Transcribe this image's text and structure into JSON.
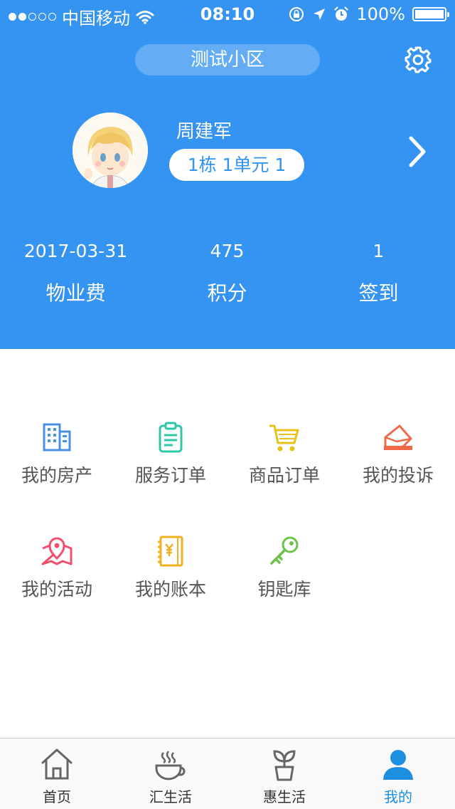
{
  "status_bar": {
    "carrier": "中国移动",
    "time": "08:10",
    "battery": "100%",
    "battery_level": 1.0,
    "signal_bars": 2
  },
  "header": {
    "community": "测试小区",
    "settings_icon": "gear-icon"
  },
  "profile": {
    "name": "周建军",
    "unit": "1栋 1单元 1",
    "avatar_icon": "avatar-cartoon"
  },
  "stats": [
    {
      "value": "2017-03-31",
      "label": "物业费"
    },
    {
      "value": "475",
      "label": "积分"
    },
    {
      "value": "1",
      "label": "签到"
    }
  ],
  "menu": [
    {
      "label": "我的房产",
      "icon": "building-icon",
      "color": "#4a90e2"
    },
    {
      "label": "服务订单",
      "icon": "clipboard-icon",
      "color": "#2ec7a8"
    },
    {
      "label": "商品订单",
      "icon": "cart-icon",
      "color": "#e6c21a"
    },
    {
      "label": "我的投诉",
      "icon": "envelope-icon",
      "color": "#f06a4a"
    },
    {
      "label": "我的活动",
      "icon": "map-pin-icon",
      "color": "#f0506e"
    },
    {
      "label": "我的账本",
      "icon": "ledger-icon",
      "color": "#f0b020"
    },
    {
      "label": "钥匙库",
      "icon": "key-icon",
      "color": "#6cc24a"
    }
  ],
  "tabs": [
    {
      "label": "首页",
      "icon": "home-icon"
    },
    {
      "label": "汇生活",
      "icon": "coffee-icon"
    },
    {
      "label": "惠生活",
      "icon": "plant-icon"
    },
    {
      "label": "我的",
      "icon": "user-icon"
    }
  ],
  "colors": {
    "brand": "#3593f2",
    "active_tab": "#1e8fe0"
  }
}
